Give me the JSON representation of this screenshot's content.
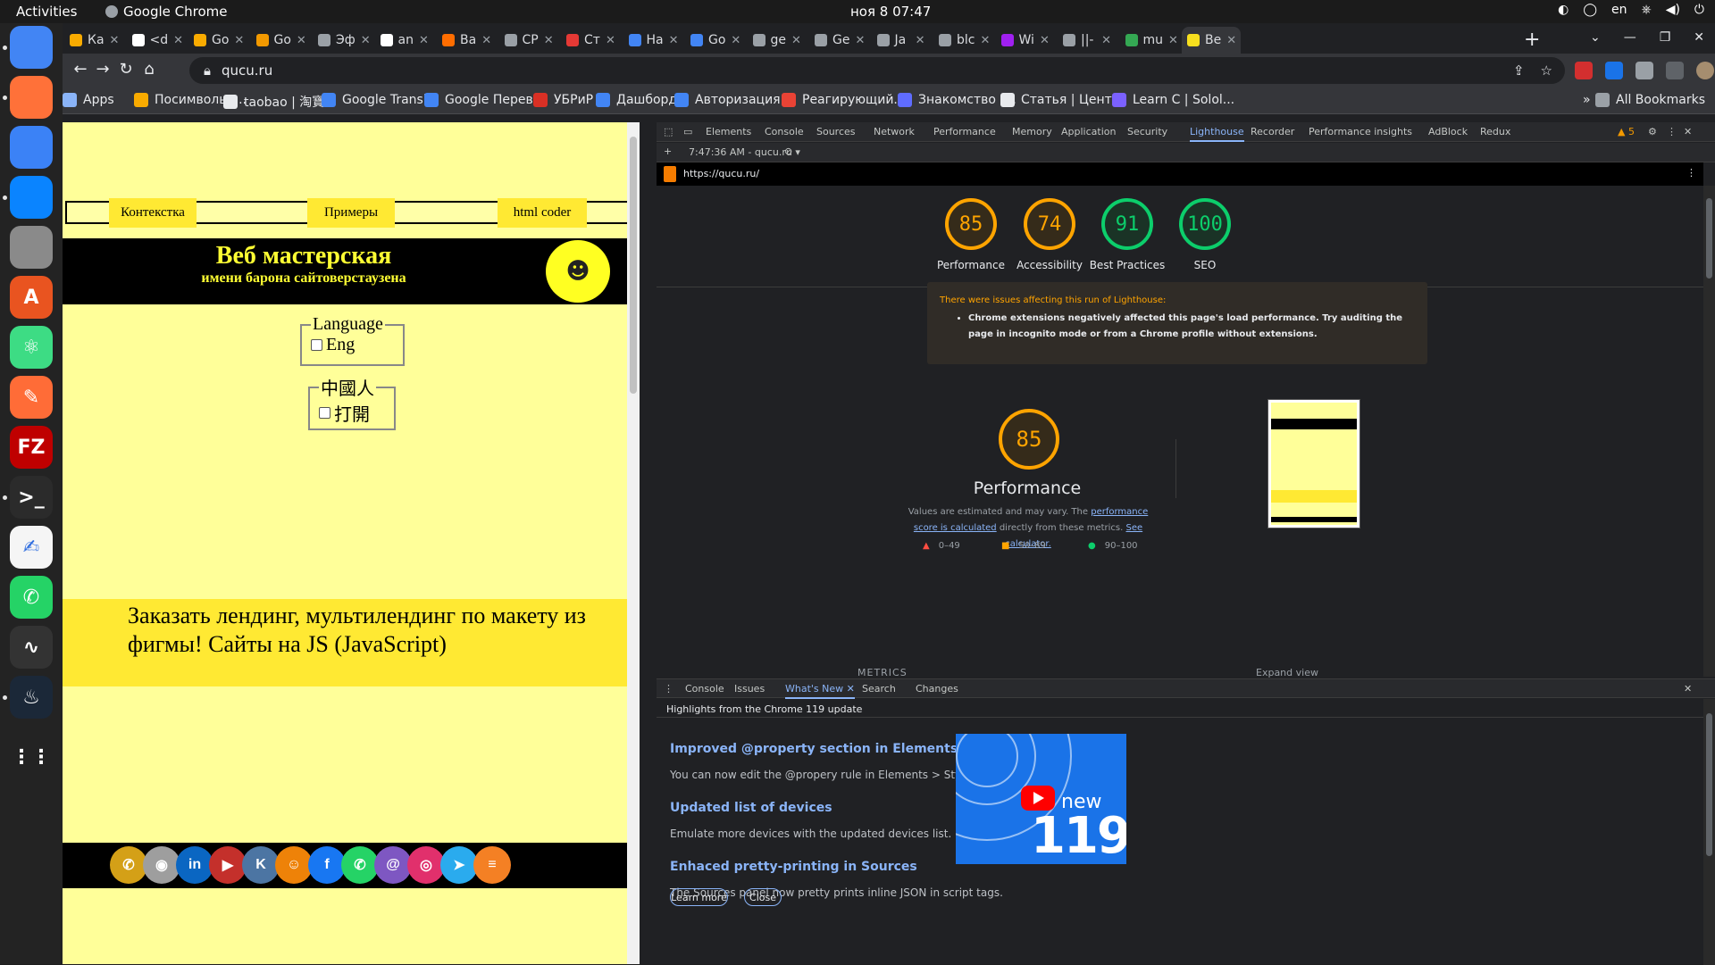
{
  "system": {
    "activities": "Activities",
    "app_name": "Google Chrome",
    "clock": "ноя 8  07:47",
    "lang": "en"
  },
  "dock": [
    {
      "name": "chrome-icon",
      "glyph": "",
      "color": "#4285f4"
    },
    {
      "name": "firefox-icon",
      "glyph": "",
      "color": "#ff7139"
    },
    {
      "name": "browser-icon",
      "glyph": "",
      "color": "#3b82f6"
    },
    {
      "name": "thunderbird-icon",
      "glyph": "",
      "color": "#0a84ff"
    },
    {
      "name": "files-icon",
      "glyph": "",
      "color": "#8a8a8a"
    },
    {
      "name": "app-center-icon",
      "glyph": "A",
      "color": "#e95420"
    },
    {
      "name": "atom-icon",
      "glyph": "⚛",
      "color": "#3ddc84"
    },
    {
      "name": "postman-icon",
      "glyph": "✎",
      "color": "#ff6c37"
    },
    {
      "name": "filezilla-icon",
      "glyph": "FZ",
      "color": "#bf0000"
    },
    {
      "name": "terminal-icon",
      "glyph": ">_",
      "color": "#2b2b2b"
    },
    {
      "name": "text-editor-icon",
      "glyph": "✍",
      "color": "#f5f5f5"
    },
    {
      "name": "whatsapp-icon",
      "glyph": "✆",
      "color": "#25d366"
    },
    {
      "name": "system-monitor-icon",
      "glyph": "∿",
      "color": "#333333"
    },
    {
      "name": "steam-icon",
      "glyph": "♨",
      "color": "#1b2838"
    }
  ],
  "tabs": [
    {
      "label": "Ка",
      "color": "#f9ab00"
    },
    {
      "label": "<d",
      "color": "#ffffff"
    },
    {
      "label": "Go",
      "color": "#f9ab00"
    },
    {
      "label": "Go",
      "color": "#f29900"
    },
    {
      "label": "Эф",
      "color": "#9aa0a6"
    },
    {
      "label": "an",
      "color": "#ffffff"
    },
    {
      "label": "Ва",
      "color": "#ff6d00"
    },
    {
      "label": "CP",
      "color": "#9aa0a6"
    },
    {
      "label": "Ст",
      "color": "#e53935"
    },
    {
      "label": "Ha",
      "color": "#4285f4"
    },
    {
      "label": "Go",
      "color": "#4285f4"
    },
    {
      "label": "ge",
      "color": "#9aa0a6"
    },
    {
      "label": "Ge",
      "color": "#9aa0a6"
    },
    {
      "label": "Ja",
      "color": "#9aa0a6"
    },
    {
      "label": "blc",
      "color": "#9aa0a6"
    },
    {
      "label": "Wi",
      "color": "#a020f0"
    },
    {
      "label": "||-",
      "color": "#9aa0a6"
    },
    {
      "label": "mu",
      "color": "#34a853"
    },
    {
      "label": "Be",
      "color": "#f7df1e",
      "active": true
    }
  ],
  "address": {
    "url": "qucu.ru"
  },
  "bookmarks": [
    {
      "label": "Apps",
      "color": "#8ab4f8"
    },
    {
      "label": "Посимвольн...",
      "color": "#f9ab00"
    },
    {
      "label": "taobao | 淘寶",
      "color": "#e8eaed"
    },
    {
      "label": "Google Transl...",
      "color": "#4285f4"
    },
    {
      "label": "Google Перев...",
      "color": "#4285f4"
    },
    {
      "label": "УБРиР",
      "color": "#d93025"
    },
    {
      "label": "Дашборд",
      "color": "#4285f4"
    },
    {
      "label": "Авторизация...",
      "color": "#4285f4"
    },
    {
      "label": "Реагирующий...",
      "color": "#ea4335"
    },
    {
      "label": "Знакомство -...",
      "color": "#5f6cff"
    },
    {
      "label": "Статья | Цент...",
      "color": "#e8eaed"
    },
    {
      "label": "Learn C | Solol...",
      "color": "#7b61ff"
    }
  ],
  "all_bookmarks": "All Bookmarks",
  "site": {
    "menu": [
      "Контекстка",
      "Примеры",
      "html coder"
    ],
    "title": "Веб мастерская",
    "subtitle": "имени барона сайтоверстаузена",
    "lang_legend": "Language",
    "lang_option": "Eng",
    "cn_legend": "中國人",
    "cn_option": "打開",
    "promo_text": "Заказать лендинг, мультилендинг по макету из фигмы! Сайты на JS (JavaScript)",
    "social": [
      {
        "name": "phone-icon",
        "glyph": "✆",
        "color": "#d4a017"
      },
      {
        "name": "owl-icon",
        "glyph": "◉",
        "color": "#9e9e9e"
      },
      {
        "name": "linkedin-icon",
        "glyph": "in",
        "color": "#0a66c2"
      },
      {
        "name": "youtube-icon",
        "glyph": "▶",
        "color": "#c4302b"
      },
      {
        "name": "vk-icon",
        "glyph": "K",
        "color": "#4c75a3"
      },
      {
        "name": "ok-icon",
        "glyph": "☺",
        "color": "#ee8208"
      },
      {
        "name": "facebook-icon",
        "glyph": "f",
        "color": "#1877f2"
      },
      {
        "name": "whatsapp-icon",
        "glyph": "✆",
        "color": "#25d366"
      },
      {
        "name": "email-icon",
        "glyph": "@",
        "color": "#7e57c2"
      },
      {
        "name": "instagram-icon",
        "glyph": "◎",
        "color": "#e1306c"
      },
      {
        "name": "telegram-icon",
        "glyph": "➤",
        "color": "#2aabee"
      },
      {
        "name": "stackoverflow-icon",
        "glyph": "≡",
        "color": "#f48024"
      }
    ]
  },
  "devtools": {
    "tabs": [
      "Elements",
      "Console",
      "Sources",
      "Network",
      "Performance",
      "Memory",
      "Application",
      "Security",
      "Lighthouse",
      "Recorder",
      "Performance insights",
      "AdBlock",
      "Redux"
    ],
    "active_tab": "Lighthouse",
    "issues_count": "5",
    "report_time": "7:47:36 AM - qucu.ru",
    "report_url": "https://qucu.ru/",
    "scores": [
      {
        "value": "85",
        "label": "Performance",
        "color": "#ffa400"
      },
      {
        "value": "74",
        "label": "Accessibility",
        "color": "#ffa400"
      },
      {
        "value": "91",
        "label": "Best Practices",
        "color": "#0cce6b"
      },
      {
        "value": "100",
        "label": "SEO",
        "color": "#0cce6b"
      }
    ],
    "warning_title": "There were issues affecting this run of Lighthouse:",
    "warning_item": "Chrome extensions negatively affected this page's load performance. Try auditing the page in incognito mode or from a Chrome profile without extensions.",
    "perf_score": "85",
    "perf_title": "Performance",
    "perf_note_1": "Values are estimated and may vary. The ",
    "perf_link_1": "performance score is calculated",
    "perf_note_2": " directly from these metrics. ",
    "perf_link_2": "See calculator.",
    "legend": [
      {
        "label": "0–49",
        "color": "#ff4e42",
        "shape": "▲"
      },
      {
        "label": "50–89",
        "color": "#ffa400",
        "shape": "■"
      },
      {
        "label": "90–100",
        "color": "#0cce6b",
        "shape": "●"
      }
    ],
    "metrics_label": "METRICS",
    "expand_label": "Expand view",
    "drawer_tabs": [
      "Console",
      "Issues",
      "What's New",
      "Search",
      "Changes"
    ],
    "drawer_active": "What's New",
    "highlights": "Highlights from the Chrome 119 update",
    "news": [
      {
        "title": "Improved @property section in Elements > Styles",
        "desc": "You can now edit the @propery rule in Elements > Styles."
      },
      {
        "title": "Updated list of devices",
        "desc": "Emulate more devices with the updated devices list."
      },
      {
        "title": "Enhaced pretty-printing in Sources",
        "desc": "The Sources panel now pretty prints inline JSON in script tags."
      }
    ],
    "promo_new": "new",
    "promo_num": "119",
    "learn_more": "Learn more",
    "close": "Close"
  }
}
